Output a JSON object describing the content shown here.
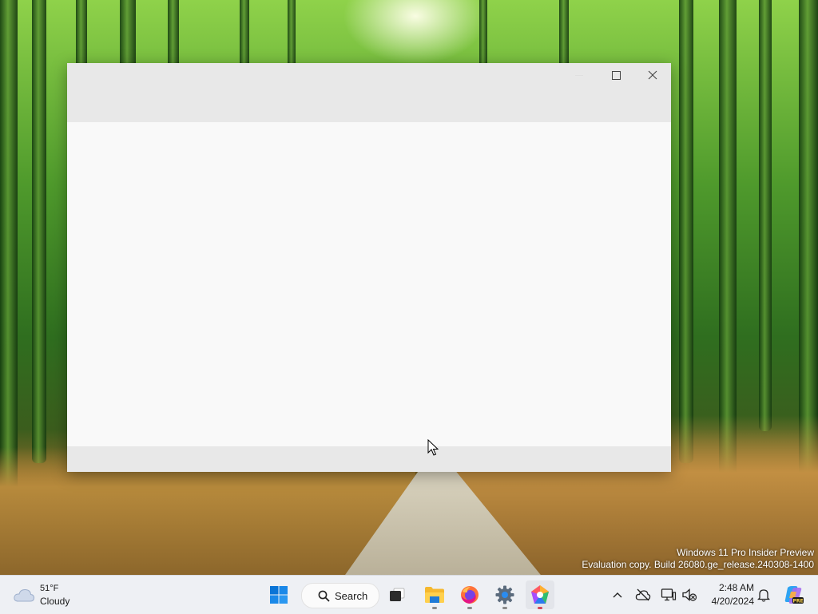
{
  "watermark": {
    "line1": "Windows 11 Pro Insider Preview",
    "line2": "Evaluation copy. Build 26080.ge_release.240308-1400"
  },
  "window": {
    "caption_buttons": [
      "minimize",
      "maximize",
      "close"
    ]
  },
  "taskbar": {
    "weather": {
      "temp": "51°F",
      "condition": "Cloudy",
      "icon": "cloud-icon"
    },
    "start_icon": "windows-logo-icon",
    "search_label": "Search",
    "pinned_apps": [
      {
        "name": "Task View",
        "icon": "task-view-icon",
        "running": false
      },
      {
        "name": "File Explorer",
        "icon": "folder-icon",
        "running": true
      },
      {
        "name": "Firefox",
        "icon": "firefox-icon",
        "running": true
      },
      {
        "name": "Settings",
        "icon": "settings-gear-icon",
        "running": true
      },
      {
        "name": "App",
        "icon": "gem-app-icon",
        "running": true
      }
    ],
    "tray": {
      "icons": [
        "chevron-up-icon",
        "onedrive-offline-icon",
        "network-display-icon",
        "volume-muted-icon",
        "notification-bell-icon",
        "copilot-pre-icon"
      ]
    },
    "clock": {
      "time": "2:48 AM",
      "date": "4/20/2024"
    }
  },
  "colors": {
    "taskbar_bg": "#eef0f4",
    "window_chrome": "#e8e8e8",
    "window_content": "#f9f9f9",
    "windows_blue": "#0a74d6"
  }
}
